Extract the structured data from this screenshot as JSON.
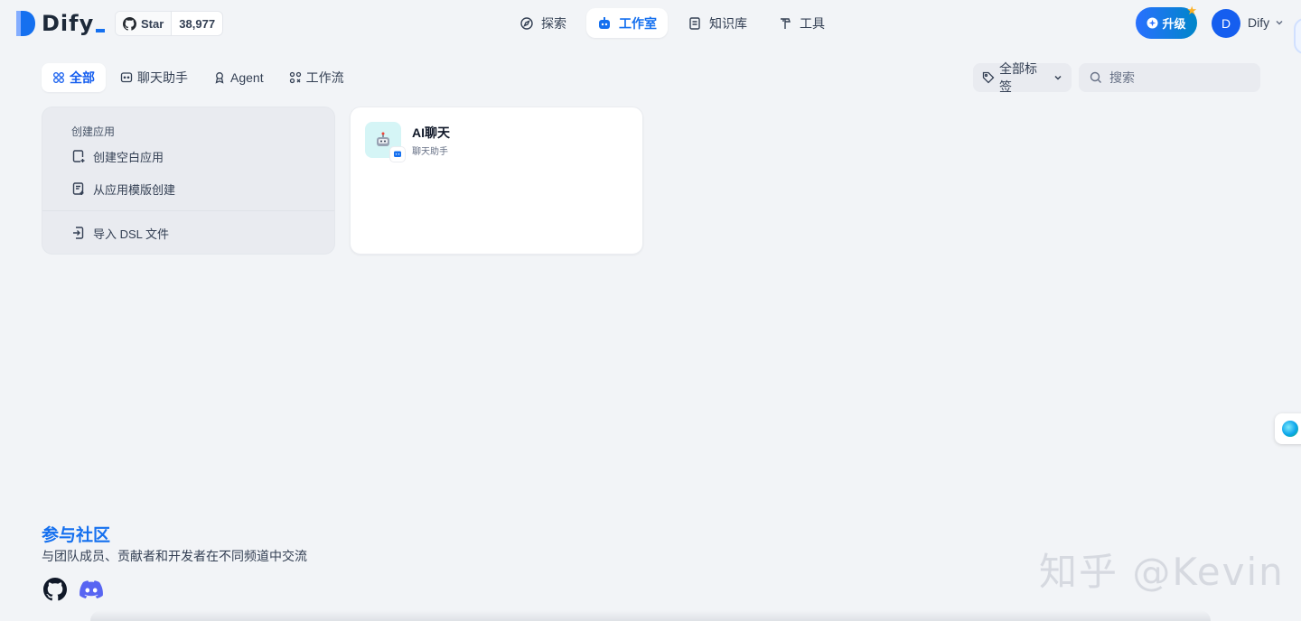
{
  "header": {
    "logo_text": "Dify",
    "github_star_label": "Star",
    "github_star_count": "38,977",
    "nav": [
      {
        "label": "探索",
        "icon": "explore-icon"
      },
      {
        "label": "工作室",
        "icon": "robot-icon",
        "active": true
      },
      {
        "label": "知识库",
        "icon": "book-icon"
      },
      {
        "label": "工具",
        "icon": "hammer-icon"
      }
    ],
    "upgrade_label": "升级",
    "user_initial": "D",
    "user_name": "Dify"
  },
  "tabs": [
    {
      "label": "全部",
      "icon": "grid-icon",
      "active": true
    },
    {
      "label": "聊天助手",
      "icon": "chat-icon"
    },
    {
      "label": "Agent",
      "icon": "agent-icon"
    },
    {
      "label": "工作流",
      "icon": "workflow-icon"
    }
  ],
  "filter": {
    "tag_label": "全部标签",
    "search_placeholder": "搜索"
  },
  "create_card": {
    "title": "创建应用",
    "items": [
      "创建空白应用",
      "从应用模版创建",
      "导入 DSL 文件"
    ]
  },
  "apps": [
    {
      "name": "AI聊天",
      "type": "聊天助手",
      "icon": "robot-emoji",
      "icon_bg": "#d5f5f6"
    }
  ],
  "community": {
    "title": "参与社区",
    "description": "与团队成员、贡献者和开发者在不同频道中交流"
  },
  "watermark": "知乎 @Kevin",
  "colors": {
    "accent": "#1570ef",
    "background": "#f2f4f7"
  }
}
